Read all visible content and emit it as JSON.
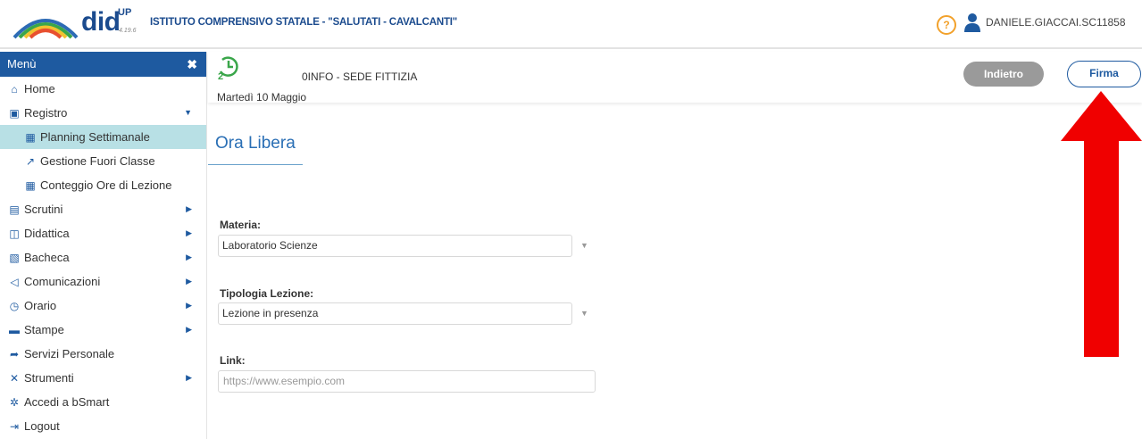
{
  "header": {
    "logo_text": "did",
    "logo_superscript": "UP",
    "version": "4.19.6",
    "school_name": "ISTITUTO COMPRENSIVO STATALE - \"SALUTATI - CAVALCANTI\"",
    "help_label": "?",
    "user_name": "DANIELE.GIACCAI.SC11858"
  },
  "sidebar": {
    "title": "Menù",
    "close_label": "✖",
    "items": [
      {
        "label": "Home",
        "icon": "home-icon"
      },
      {
        "label": "Registro",
        "icon": "calendar-check-icon"
      },
      {
        "label": "Planning Settimanale",
        "icon": "calendar-icon"
      },
      {
        "label": "Gestione Fuori Classe",
        "icon": "external-link-icon"
      },
      {
        "label": "Conteggio Ore di Lezione",
        "icon": "table-icon"
      },
      {
        "label": "Scrutini",
        "icon": "scrutini-icon"
      },
      {
        "label": "Didattica",
        "icon": "book-icon"
      },
      {
        "label": "Bacheca",
        "icon": "bulletin-icon"
      },
      {
        "label": "Comunicazioni",
        "icon": "megaphone-icon"
      },
      {
        "label": "Orario",
        "icon": "clock-icon"
      },
      {
        "label": "Stampe",
        "icon": "printer-icon"
      },
      {
        "label": "Servizi Personale",
        "icon": "share-icon"
      },
      {
        "label": "Strumenti",
        "icon": "tools-icon"
      },
      {
        "label": "Accedi a bSmart",
        "icon": "bsmart-icon"
      },
      {
        "label": "Logout",
        "icon": "logout-icon"
      }
    ]
  },
  "content_header": {
    "class_name": "0INFO - SEDE FITTIZIA",
    "date": "Martedì 10 Maggio",
    "back_label": "Indietro",
    "sign_label": "Firma"
  },
  "main": {
    "title": "Ora Libera",
    "subject_label": "Materia:",
    "subject_value": "Laboratorio Scienze",
    "lesson_type_label": "Tipologia Lezione:",
    "lesson_type_value": "Lezione in presenza",
    "link_label": "Link:",
    "link_placeholder": "https://www.esempio.com"
  },
  "colors": {
    "brand_blue": "#1e5aa0",
    "active_item": "#b8e0e5",
    "arrow_red": "#f00000",
    "back_button": "#9a9a9a",
    "clock_green": "#3aa64a"
  }
}
